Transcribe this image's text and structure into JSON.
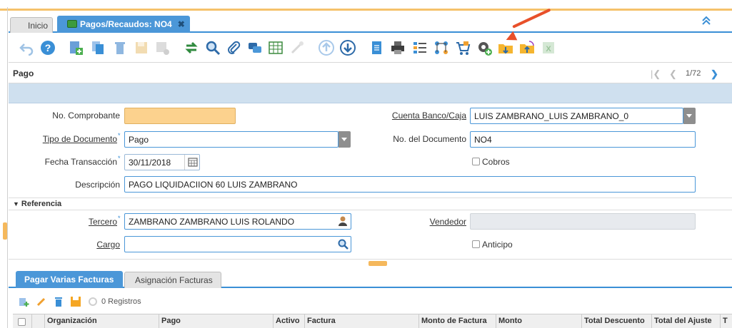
{
  "tabs": {
    "home": "Inicio",
    "active": "Pagos/Recaudos: NO4"
  },
  "toolbar": {
    "icons": [
      "undo-icon",
      "help-icon",
      "new-record-icon",
      "copy-icon",
      "delete-icon",
      "save-icon",
      "save-new-icon",
      "refresh-icon",
      "search-icon",
      "attachment-icon",
      "chat-icon",
      "grid-toggle-icon",
      "zoom-across-icon",
      "parent-record-icon",
      "detail-record-icon",
      "report-icon",
      "print-icon",
      "product-info-icon",
      "workflow-icon",
      "shopping-cart-icon",
      "process-icon",
      "export-icon",
      "import-icon",
      "excel-icon"
    ]
  },
  "header": {
    "title": "Pago",
    "record_count": "1/72"
  },
  "form": {
    "no_comprobante_label": "No. Comprobante",
    "no_comprobante_value": "",
    "tipo_documento_label": "Tipo de Documento",
    "tipo_documento_value": "Pago",
    "fecha_transaccion_label": "Fecha Transacción",
    "fecha_transaccion_value": "30/11/2018",
    "descripcion_label": "Descripción",
    "descripcion_value": "PAGO LIQUIDACIION 60 LUIS ZAMBRANO",
    "cuenta_banco_label": "Cuenta Banco/Caja",
    "cuenta_banco_value": "LUIS ZAMBRANO_LUIS ZAMBRANO_0",
    "no_documento_label": "No. del Documento",
    "no_documento_value": "NO4",
    "cobros_label": "Cobros",
    "cobros_checked": false
  },
  "referencia": {
    "section_label": "Referencia",
    "tercero_label": "Tercero",
    "tercero_value": "ZAMBRANO ZAMBRANO LUIS ROLANDO",
    "cargo_label": "Cargo",
    "cargo_value": "",
    "vendedor_label": "Vendedor",
    "vendedor_value": "",
    "anticipo_label": "Anticipo",
    "anticipo_checked": false
  },
  "detail_tabs": {
    "tab1": "Pagar Varias Facturas",
    "tab2": "Asignación Facturas"
  },
  "grid": {
    "registros": "0 Registros",
    "columns": [
      "Organización",
      "Pago",
      "Activo",
      "Factura",
      "Monto de Factura",
      "Monto",
      "Total Descuento",
      "Total del Ajuste",
      "T"
    ]
  },
  "colors": {
    "accent": "#4b97d8",
    "required_field": "#fcd28e",
    "arrow": "#e8502a",
    "header_band": "#cfe0ef"
  }
}
